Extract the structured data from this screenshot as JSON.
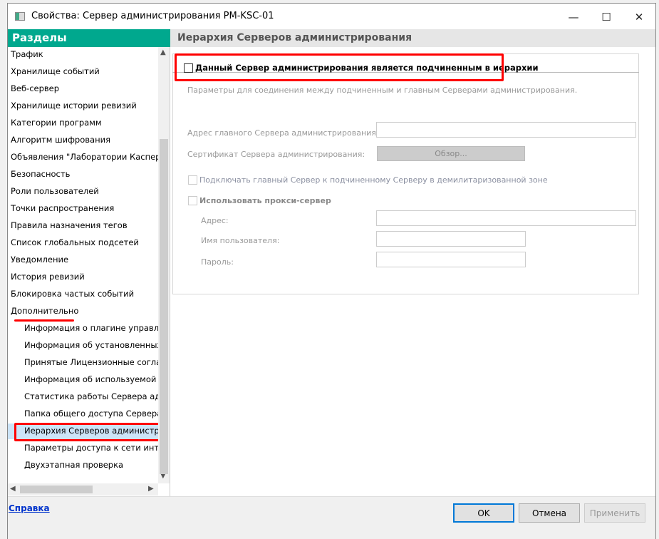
{
  "window": {
    "title": "Свойства: Сервер администрирования PM-KSC-01"
  },
  "sidebar": {
    "header": "Разделы",
    "items": [
      {
        "label": "Трафик"
      },
      {
        "label": "Хранилище событий"
      },
      {
        "label": "Веб-сервер"
      },
      {
        "label": "Хранилище истории ревизий"
      },
      {
        "label": "Категории программ"
      },
      {
        "label": "Алгоритм шифрования"
      },
      {
        "label": "Объявления \"Лаборатории Касперского\""
      },
      {
        "label": "Безопасность"
      },
      {
        "label": "Роли пользователей"
      },
      {
        "label": "Точки распространения"
      },
      {
        "label": "Правила назначения тегов"
      },
      {
        "label": "Список глобальных подсетей"
      },
      {
        "label": "Уведомление"
      },
      {
        "label": "История ревизий"
      },
      {
        "label": "Блокировка частых событий"
      },
      {
        "label": "Дополнительно"
      },
      {
        "label": "Информация о плагине управления С"
      },
      {
        "label": "Информация об установленных плаги"
      },
      {
        "label": "Принятые Лицензионные соглашения"
      },
      {
        "label": "Информация об используемой базе д"
      },
      {
        "label": "Статистика работы Сервера админи"
      },
      {
        "label": "Папка общего доступа Сервера адми"
      },
      {
        "label": "Иерархия Серверов администрирова"
      },
      {
        "label": "Параметры доступа к сети интернет"
      },
      {
        "label": "Двухэтапная проверка"
      }
    ]
  },
  "main": {
    "header": "Иерархия Серверов администрирования",
    "subordinate_checkbox": {
      "label": "Данный Сервер администрирования является подчиненным в иерархии",
      "checked": false
    },
    "description": "Параметры для соединения между подчиненным и главным Серверами администрирования.",
    "master_address_label": "Адрес главного Сервера администрирования:",
    "master_address_value": "",
    "certificate_label": "Сертификат Сервера администрирования:",
    "browse_button": "Обзор...",
    "dmz_checkbox": {
      "label": "Подключать главный Сервер к подчиненному Серверу в демилитаризованной зоне",
      "checked": false
    },
    "proxy_checkbox": {
      "label": "Использовать прокси-сервер",
      "checked": false
    },
    "proxy_address_label": "Адрес:",
    "proxy_user_label": "Имя пользователя:",
    "proxy_password_label": "Пароль:"
  },
  "footer": {
    "help": "Справка",
    "ok": "OK",
    "cancel": "Отмена",
    "apply": "Применить"
  }
}
